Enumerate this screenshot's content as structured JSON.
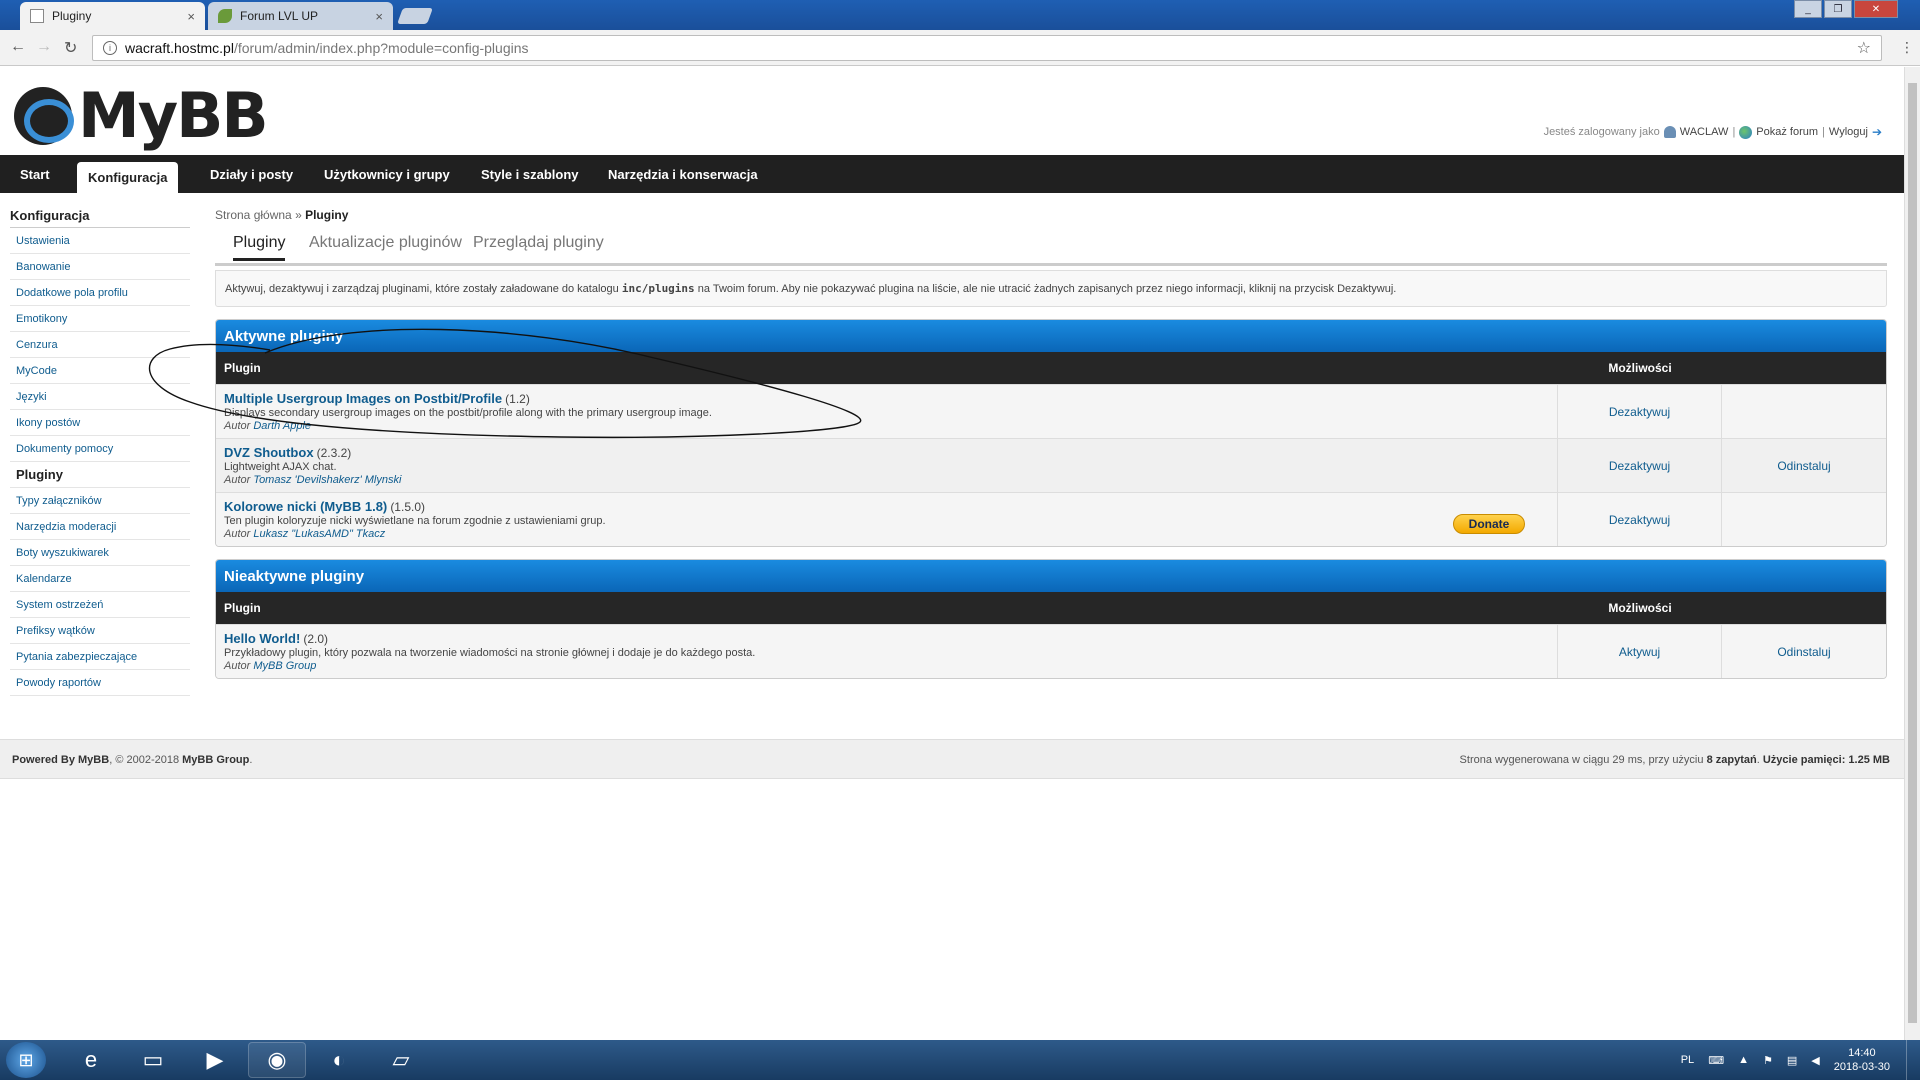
{
  "browser": {
    "tabs": [
      {
        "title": "Pluginy",
        "close": "×"
      },
      {
        "title": "Forum LVL UP",
        "close": "×"
      }
    ],
    "url_host": "wacraft.hostmc.pl",
    "url_path": "/forum/admin/index.php?module=config-plugins",
    "back_icon": "←",
    "forward_icon": "→",
    "reload_icon": "↻",
    "info_icon": "i",
    "star_icon": "☆",
    "menu_icon": "⋮",
    "window_controls": [
      "_",
      "❐",
      "✕"
    ]
  },
  "header": {
    "logo_text": "MyBB",
    "welcome": {
      "prefix": "Jesteś zalogowany jako",
      "username": "WACLAW",
      "sep1": "|",
      "view_forum": "Pokaż forum",
      "sep2": "|",
      "logout": "Wyloguj",
      "logout_icon": "➔"
    }
  },
  "mainnav": [
    "Start",
    "Konfiguracja",
    "Działy i posty",
    "Użytkownicy i grupy",
    "Style i szablony",
    "Narzędzia i konserwacja"
  ],
  "sidebar": {
    "title": "Konfiguracja",
    "items": [
      "Ustawienia",
      "Banowanie",
      "Dodatkowe pola profilu",
      "Emotikony",
      "Cenzura",
      "MyCode",
      "Języki",
      "Ikony postów",
      "Dokumenty pomocy",
      "Pluginy",
      "Typy załączników",
      "Narzędzia moderacji",
      "Boty wyszukiwarek",
      "Kalendarze",
      "System ostrzeżeń",
      "Prefiksy wątków",
      "Pytania zabezpieczające",
      "Powody raportów"
    ]
  },
  "breadcrumb": {
    "home": "Strona główna",
    "sep": "»",
    "current": "Pluginy"
  },
  "subtabs": [
    "Pluginy",
    "Aktualizacje pluginów",
    "Przeglądaj pluginy"
  ],
  "notice": {
    "before": "Aktywuj, dezaktywuj i zarządzaj pluginami, które zostały załadowane do katalogu ",
    "code": "inc/plugins",
    "after": " na Twoim forum. Aby nie pokazywać plugina na liście, ale nie utracić żadnych zapisanych przez niego informacji, kliknij na przycisk Dezaktywuj."
  },
  "active": {
    "heading": "Aktywne pluginy",
    "col_plugin": "Plugin",
    "col_options": "Możliwości",
    "plugins": [
      {
        "name": "Multiple Usergroup Images on Postbit/Profile",
        "version": "(1.2)",
        "desc": "Displays secondary usergroup images on the postbit/profile along with the primary usergroup image.",
        "author_label": "Autor",
        "author": "Darth Apple",
        "action1": "Dezaktywuj",
        "action2": ""
      },
      {
        "name": "DVZ Shoutbox",
        "version": "(2.3.2)",
        "desc": "Lightweight AJAX chat.",
        "author_label": "Autor",
        "author": "Tomasz 'Devilshakerz' Mlynski",
        "action1": "Dezaktywuj",
        "action2": "Odinstaluj"
      },
      {
        "name": "Kolorowe nicki (MyBB 1.8)",
        "version": "(1.5.0)",
        "desc": "Ten plugin koloryzuje nicki wyświetlane na forum zgodnie z ustawieniami grup.",
        "author_label": "Autor",
        "author": "Lukasz \"LukasAMD\" Tkacz",
        "action1": "Dezaktywuj",
        "action2": "",
        "donate": "Donate"
      }
    ]
  },
  "inactive": {
    "heading": "Nieaktywne pluginy",
    "col_plugin": "Plugin",
    "col_options": "Możliwości",
    "plugins": [
      {
        "name": "Hello World!",
        "version": "(2.0)",
        "desc": "Przykładowy plugin, który pozwala na tworzenie wiadomości na stronie głównej i dodaje je do każdego posta.",
        "author_label": "Autor",
        "author": "MyBB Group",
        "action1": "Aktywuj",
        "action2": "Odinstaluj"
      }
    ]
  },
  "footer": {
    "left_a": "Powered By MyBB",
    "left_b": ", © 2002-2018 ",
    "left_c": "MyBB Group",
    "left_d": ".",
    "right_a": "Strona wygenerowana w ciągu 29 ms, przy użyciu ",
    "right_b": "8 zapytań",
    "right_c": ". ",
    "right_d": "Użycie pamięci: 1.25 MB"
  },
  "taskbar": {
    "lang": "PL",
    "time": "14:40",
    "date": "2018-03-30"
  }
}
